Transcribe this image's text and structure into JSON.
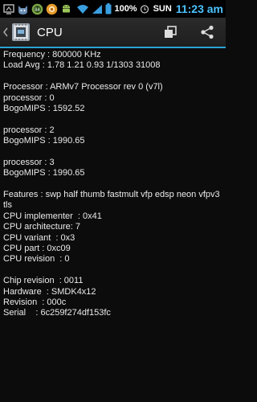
{
  "status_bar": {
    "battery_percent": "100%",
    "day": "SUN",
    "time": "11:23 am",
    "notification_icons": [
      "android-debug-icon",
      "cat-app-icon",
      "speed-test-icon",
      "browser-icon",
      "android-icon"
    ],
    "colors": {
      "time": "#4cc3ff",
      "signal": "#3a9fe0"
    }
  },
  "action_bar": {
    "title": "CPU",
    "accent_color": "#2aa3d3",
    "actions": [
      "copy-icon",
      "share-icon"
    ]
  },
  "cpu_info": {
    "frequency": "Frequency : 800000 KHz",
    "load_avg": "Load Avg : 1.78 1.21 0.93 1/1303 31008",
    "processor_name": "Processor : ARMv7 Processor rev 0 (v7l)",
    "cores": [
      {
        "processor": "processor : 0",
        "bogomips": "BogoMIPS : 1592.52"
      },
      {
        "processor": "processor : 2",
        "bogomips": "BogoMIPS : 1990.65"
      },
      {
        "processor": "processor : 3",
        "bogomips": "BogoMIPS : 1990.65"
      }
    ],
    "features_line1": "Features : swp half thumb fastmult vfp edsp neon vfpv3",
    "features_line2": "tls",
    "cpu_implementer": "CPU implementer  : 0x41",
    "cpu_architecture": "CPU architecture: 7",
    "cpu_variant": "CPU variant  : 0x3",
    "cpu_part": "CPU part : 0xc09",
    "cpu_revision": "CPU revision  : 0",
    "chip_revision": "Chip revision  : 0011",
    "hardware": "Hardware  : SMDK4x12",
    "revision": "Revision  : 000c",
    "serial": "Serial    : 6c259f274df153fc"
  }
}
